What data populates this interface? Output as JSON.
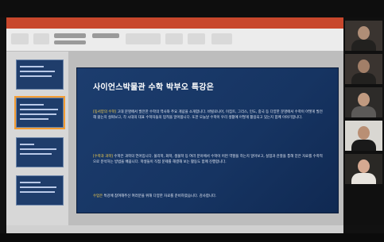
{
  "slide": {
    "title": "사이언스박물관 수학 박부오 특강은",
    "paragraphs": [
      {
        "highlight": "[동서양의 수학]",
        "text": " 고대 문명에서 발전한 수학의 역사와 주요 개념을 소개합니다. 바빌로니아, 이집트, 그리스, 인도, 중국 등 다양한 문명에서 수학이 어떻게 발전해 왔는지 살펴보고, 각 시대의 대표 수학자들의 업적을 알아봅니다. 또한 오늘날 수학이 우리 생활에 어떻게 활용되고 있는지 함께 이야기합니다."
      },
      {
        "highlight": "[수학과 과학]",
        "text": " 수학은 과학의 언어입니다. 물리학, 화학, 생물학 등 여러 분야에서 수학이 어떤 역할을 하는지 알아보고, 실험과 관찰을 통해 얻은 자료를 수학적으로 분석하는 방법을 배웁니다. 학생들이 직접 문제를 해결해 보는 활동도 함께 진행합니다."
      },
      {
        "highlight": "수업은",
        "text": " 특강에 참여해주신 여러분을 위해 다양한 자료를 준비하였습니다. 감사합니다."
      }
    ]
  },
  "thumbnails": [
    {
      "selected": false
    },
    {
      "selected": true
    },
    {
      "selected": false
    },
    {
      "selected": false
    }
  ],
  "participants": [
    {
      "icon": "participant-video"
    },
    {
      "icon": "participant-video"
    },
    {
      "icon": "participant-video"
    },
    {
      "icon": "participant-video"
    },
    {
      "icon": "participant-video"
    }
  ]
}
